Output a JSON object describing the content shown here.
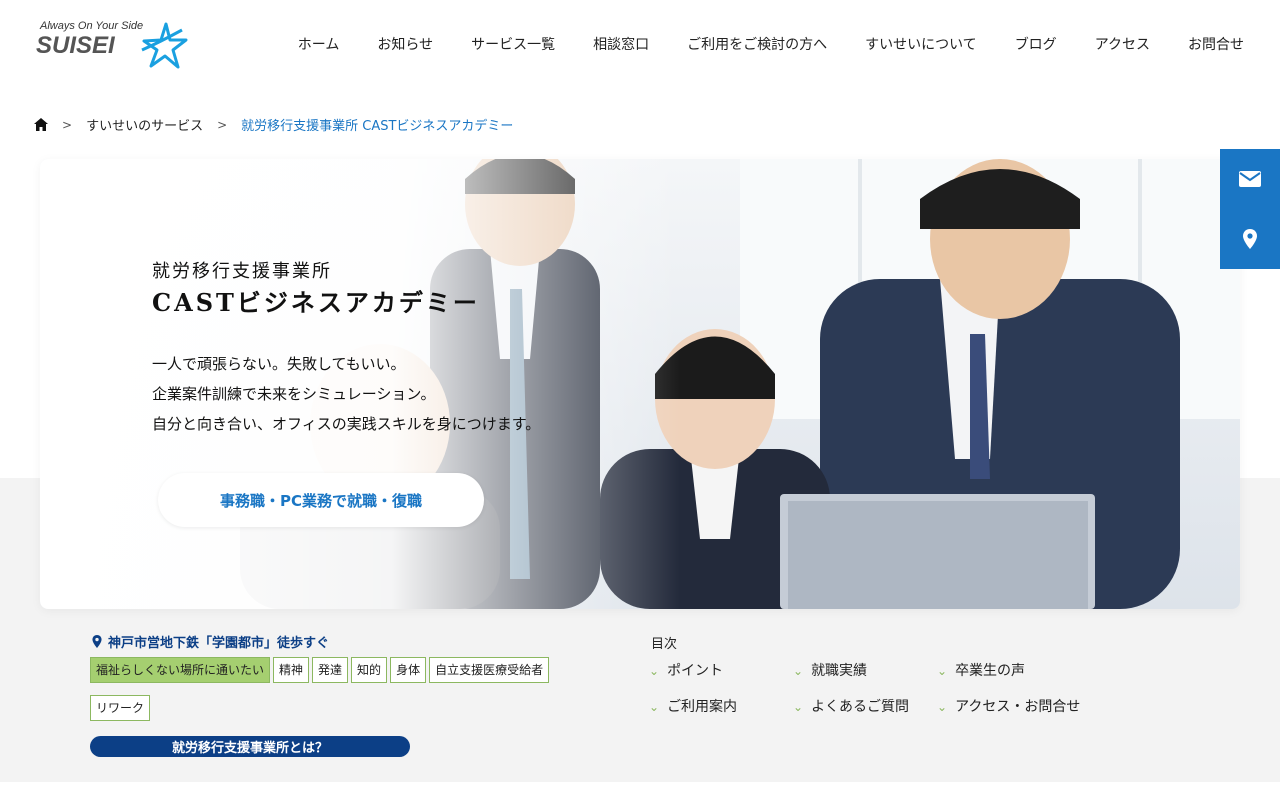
{
  "brand": {
    "tagline": "Always On Your Side",
    "name": "SUISEI"
  },
  "nav": [
    "ホーム",
    "お知らせ",
    "サービス一覧",
    "相談窓口",
    "ご利用をご検討の方へ",
    "すいせいについて",
    "ブログ",
    "アクセス",
    "お問合せ"
  ],
  "breadcrumb": {
    "items": [
      "すいせいのサービス",
      "就労移行支援事業所 CASTビジネスアカデミー"
    ]
  },
  "hero": {
    "subtitle": "就労移行支援事業所",
    "title": "CASTビジネスアカデミー",
    "lines": [
      "一人で頑張らない。失敗してもいい。",
      "企業案件訓練で未来をシミュレーション。",
      "自分と向き合い、オフィスの実践スキルを身につけます。"
    ],
    "button": "事務職・PC業務で就職・復職"
  },
  "info": {
    "location": "神戸市営地下鉄「学園都市」徒歩すぐ",
    "tags": [
      "福祉らしくない場所に通いたい",
      "精神",
      "発達",
      "知的",
      "身体",
      "自立支援医療受給者",
      "リワーク"
    ],
    "about": "就労移行支援事業所とは？"
  },
  "toc": {
    "title": "目次",
    "items": [
      "ポイント",
      "就職実績",
      "卒業生の声",
      "ご利用案内",
      "よくあるご質問",
      "アクセス・お問合せ"
    ]
  },
  "colors": {
    "accent": "#1a76c4",
    "navy": "#0c3f86",
    "green": "#a5cf70"
  },
  "icons": {
    "float": [
      "mail-icon",
      "location-pin-icon"
    ],
    "home": "home-icon"
  }
}
